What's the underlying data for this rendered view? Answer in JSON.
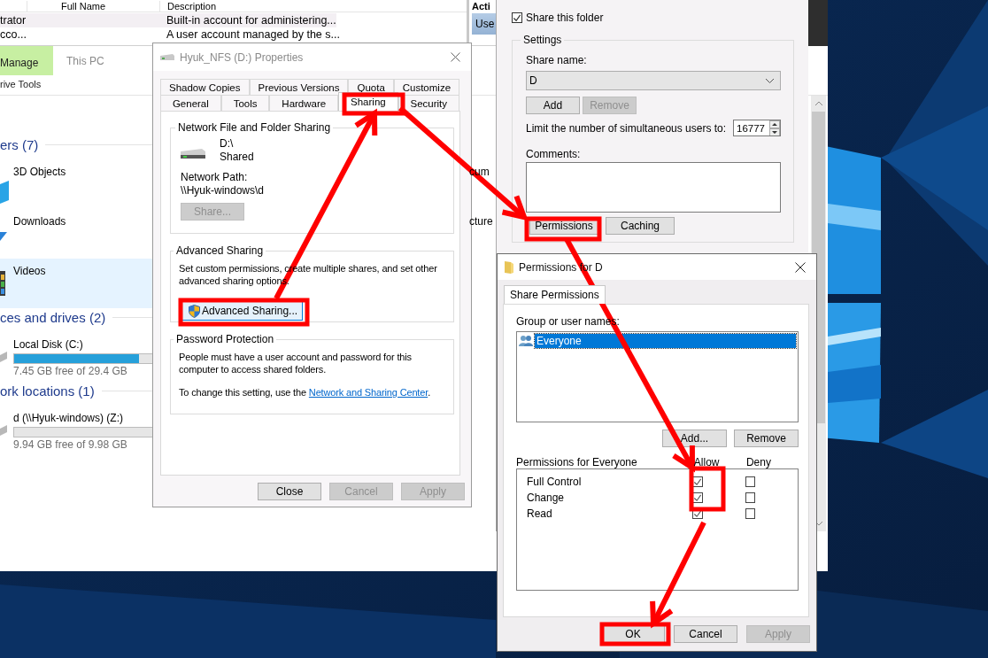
{
  "users_window": {
    "columns": [
      "Full Name",
      "Description"
    ],
    "rows": [
      {
        "name": "trator",
        "description": "Built-in account for administering...",
        "selected": true
      },
      {
        "name": "cco...",
        "description": "A user account managed by the s...",
        "selected": false
      }
    ],
    "actions": {
      "title": "Acti",
      "items": [
        {
          "label": "Use",
          "selected": true
        }
      ]
    }
  },
  "explorer": {
    "ribbon_tabs": [
      {
        "label": "Manage",
        "highlighted": true
      },
      {
        "label": "This PC",
        "highlighted": false
      }
    ],
    "ribbon_group": "rive Tools",
    "sections": [
      {
        "title": "ers (7)",
        "items": [
          {
            "kind": "cube",
            "name": "3D Objects",
            "selected": false
          },
          {
            "kind": "download",
            "name": "Downloads",
            "selected": false
          },
          {
            "kind": "video",
            "name": "Videos",
            "selected": true
          }
        ]
      },
      {
        "title": "ces and drives (2)",
        "items": [
          {
            "kind": "drive",
            "name": "Local Disk (C:)",
            "level": 0.75,
            "free": "7.45 GB free of 29.4 GB",
            "selected": false
          }
        ]
      },
      {
        "title": "ork locations (1)",
        "items": [
          {
            "kind": "drive",
            "name": "d (\\\\Hyuk-windows) (Z:)",
            "level": 0.0,
            "free": "9.94 GB free of 9.98 GB",
            "selected": false
          }
        ]
      }
    ],
    "partial_items": [
      "cum",
      "cture"
    ]
  },
  "properties_dialog": {
    "title": "Hyuk_NFS (D:) Properties",
    "tab_rows": [
      [
        {
          "label": "Shadow Copies",
          "selected": false
        },
        {
          "label": "Previous Versions",
          "selected": false
        },
        {
          "label": "Quota",
          "selected": false
        },
        {
          "label": "Customize",
          "selected": false
        }
      ],
      [
        {
          "label": "General",
          "selected": false
        },
        {
          "label": "Tools",
          "selected": false
        },
        {
          "label": "Hardware",
          "selected": false
        },
        {
          "label": "Sharing",
          "selected": true
        },
        {
          "label": "Security",
          "selected": false
        }
      ]
    ],
    "network_sharing": {
      "title": "Network File and Folder Sharing",
      "drive": "D:\\",
      "status": "Shared",
      "path_label": "Network Path:",
      "path": "\\\\Hyuk-windows\\d",
      "button": {
        "label": "Share...",
        "disabled": true
      }
    },
    "advanced_sharing": {
      "title": "Advanced Sharing",
      "text": "Set custom permissions, create multiple shares, and set other advanced sharing options.",
      "button": {
        "label": "Advanced Sharing...",
        "disabled": false
      }
    },
    "password_protection": {
      "title": "Password Protection",
      "text": "People must have a user account and password for this computer to access shared folders.",
      "change_text": "To change this setting, use the",
      "link": "Network and Sharing Center",
      "change_end": "."
    },
    "buttons": [
      {
        "label": "Close",
        "disabled": false
      },
      {
        "label": "Cancel",
        "disabled": true
      },
      {
        "label": "Apply",
        "disabled": true
      }
    ]
  },
  "advanced_sharing_window": {
    "share_checkbox": {
      "label": "Share this folder",
      "checked": true
    },
    "settings": {
      "title": "Settings",
      "share_name_label": "Share name:",
      "share_name": "D",
      "buttons": [
        {
          "label": "Add",
          "disabled": false
        },
        {
          "label": "Remove",
          "disabled": true
        }
      ],
      "limit_label": "Limit the number of simultaneous users to:",
      "limit_value": "16777",
      "comments_label": "Comments:",
      "actions": [
        {
          "label": "Permissions",
          "disabled": false
        },
        {
          "label": "Caching",
          "disabled": false
        }
      ]
    }
  },
  "permissions_dialog": {
    "title": "Permissions for D",
    "tabs": [
      {
        "label": "Share Permissions",
        "selected": true
      }
    ],
    "group_label": "Group or user names:",
    "principals": [
      {
        "name": "Everyone",
        "selected": true
      }
    ],
    "buttons": [
      {
        "label": "Add...",
        "disabled": false
      },
      {
        "label": "Remove",
        "disabled": false
      }
    ],
    "permissions_label": "Permissions for Everyone",
    "columns": [
      "Allow",
      "Deny"
    ],
    "permissions": [
      {
        "name": "Full Control",
        "allow": true,
        "deny": false
      },
      {
        "name": "Change",
        "allow": true,
        "deny": false
      },
      {
        "name": "Read",
        "allow": true,
        "deny": false
      }
    ],
    "footer_buttons": [
      {
        "label": "OK",
        "disabled": false
      },
      {
        "label": "Cancel",
        "disabled": false
      },
      {
        "label": "Apply",
        "disabled": true
      }
    ]
  }
}
